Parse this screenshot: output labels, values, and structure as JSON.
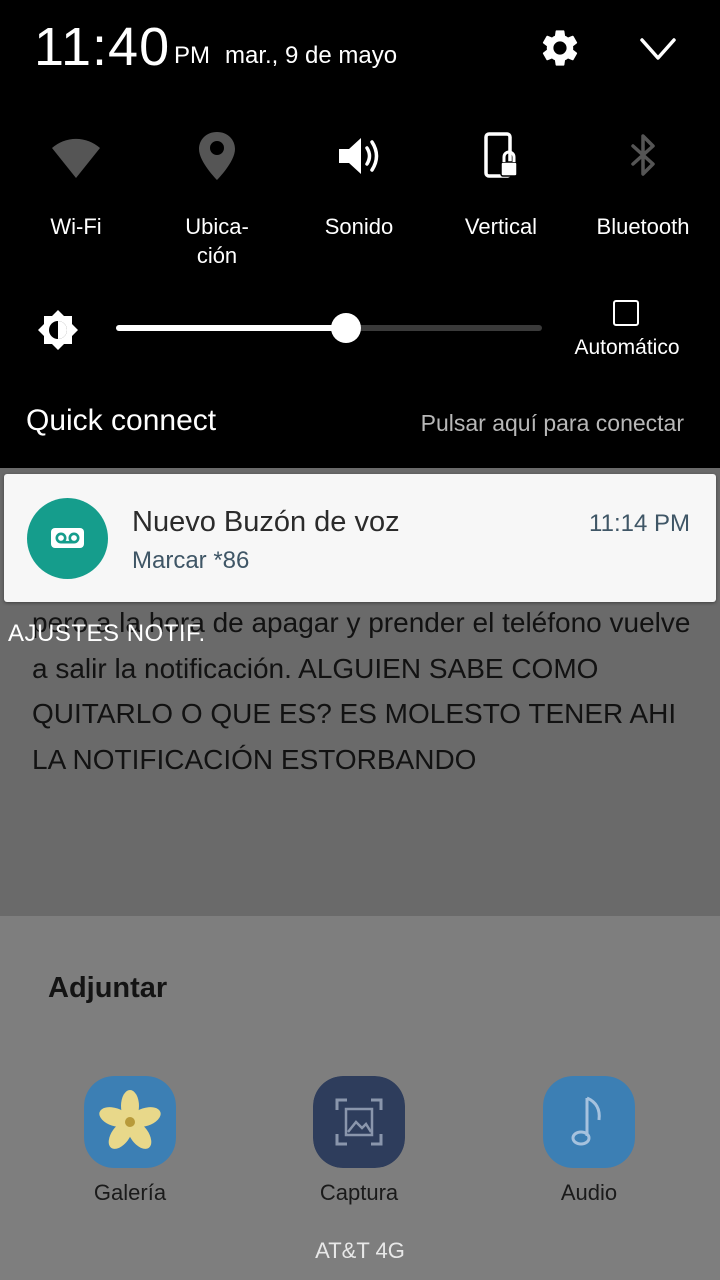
{
  "status": {
    "time": "11:40",
    "ampm": "PM",
    "date": "mar., 9 de mayo"
  },
  "header_icons": {
    "settings": "gear-icon",
    "collapse": "chevron-down-icon"
  },
  "quick_settings": [
    {
      "label": "Wi-Fi",
      "icon": "wifi-icon",
      "active": false
    },
    {
      "label": "Ubica-\nción",
      "icon": "location-icon",
      "active": false
    },
    {
      "label": "Sonido",
      "icon": "volume-icon",
      "active": true
    },
    {
      "label": "Vertical",
      "icon": "rotation-lock-icon",
      "active": true
    },
    {
      "label": "Bluetooth",
      "icon": "bluetooth-icon",
      "active": false
    }
  ],
  "brightness": {
    "level": 0.54,
    "auto_label": "Automático",
    "auto_checked": false
  },
  "quick_connect": {
    "title": "Quick connect",
    "hint": "Pulsar aquí para conectar"
  },
  "notification": {
    "title": "Nuevo Buzón de voz",
    "subtitle": "Marcar *86",
    "time": "11:14 PM",
    "icon": "voicemail-icon",
    "accent": "#159d8c"
  },
  "notif_settings_label": "AJUSTES NOTIF.",
  "background_text": "pero a la hora de apagar y prender el teléfono vuelve a salir la notificación. ALGUIEN SABE COMO QUITARLO O QUE ES? ES MOLESTO TENER AHI LA NOTIFICACIÓN ESTORBANDO",
  "attach": {
    "title": "Adjuntar",
    "apps": [
      {
        "label": "Galería",
        "icon": "gallery-icon"
      },
      {
        "label": "Captura",
        "icon": "capture-icon"
      },
      {
        "label": "Audio",
        "icon": "audio-icon"
      }
    ]
  },
  "carrier": "AT&T 4G"
}
